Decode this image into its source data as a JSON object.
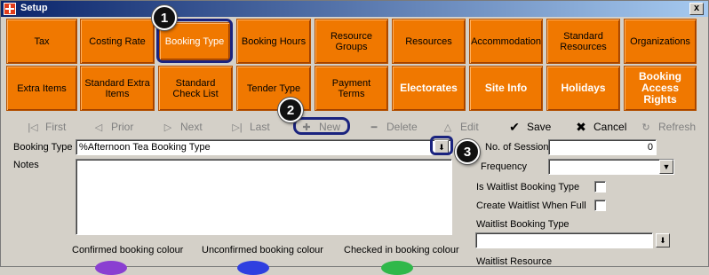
{
  "window": {
    "title": "Setup",
    "close_symbol": "x"
  },
  "tabs_row1": [
    {
      "label": "Tax"
    },
    {
      "label": "Costing Rate"
    },
    {
      "label": "Booking Type"
    },
    {
      "label": "Booking Hours"
    },
    {
      "label": "Resource Groups"
    },
    {
      "label": "Resources"
    },
    {
      "label": "Accommodation"
    },
    {
      "label": "Standard Resources"
    },
    {
      "label": "Organizations"
    }
  ],
  "tabs_row2": [
    {
      "label": "Extra Items"
    },
    {
      "label": "Standard Extra Items"
    },
    {
      "label": "Standard Check List"
    },
    {
      "label": "Tender Type"
    },
    {
      "label": "Payment Terms"
    },
    {
      "label": "Electorates"
    },
    {
      "label": "Site Info"
    },
    {
      "label": "Holidays"
    },
    {
      "label": "Booking Access Rights"
    }
  ],
  "toolbar": {
    "first": "First",
    "prior": "Prior",
    "next": "Next",
    "last": "Last",
    "new": "New",
    "delete": "Delete",
    "edit": "Edit",
    "save": "Save",
    "cancel": "Cancel",
    "refresh": "Refresh"
  },
  "form": {
    "booking_type_label": "Booking Type",
    "booking_type_value": "%Afternoon Tea Booking Type",
    "notes_label": "Notes",
    "notes_value": "",
    "no_of_sessions_label": "No. of Sessions",
    "no_of_sessions_value": "0",
    "frequency_label": "Frequency",
    "frequency_value": "",
    "is_waitlist_label": "Is Waitlist Booking Type",
    "create_waitlist_label": "Create Waitlist When Full",
    "waitlist_booking_type_label": "Waitlist Booking Type",
    "waitlist_booking_type_value": "",
    "waitlist_resource_label": "Waitlist Resource"
  },
  "colours": {
    "confirmed_label": "Confirmed booking colour",
    "unconfirmed_label": "Unconfirmed booking colour",
    "checked_in_label": "Checked in booking colour",
    "confirmed_color": "#8a3fd1",
    "unconfirmed_color": "#2f3fe0",
    "checked_in_color": "#2fb84a"
  },
  "callouts": [
    "1",
    "2",
    "3"
  ],
  "theme": {
    "tab_orange": "#f07800",
    "highlight_navy": "#1a237e"
  }
}
